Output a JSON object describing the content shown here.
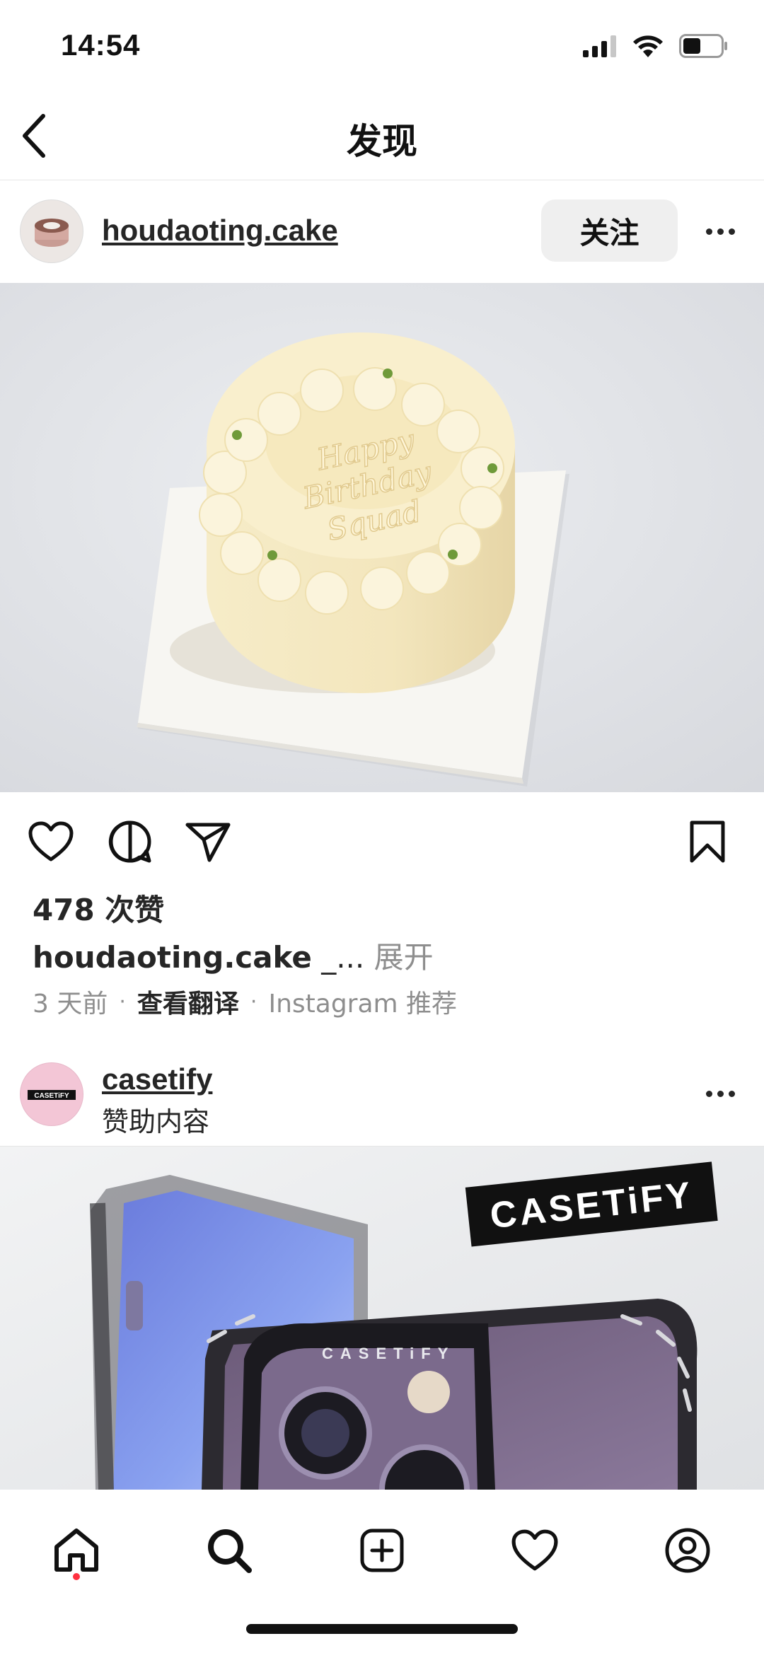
{
  "status_bar": {
    "time": "14:54"
  },
  "header": {
    "title": "发现"
  },
  "post": {
    "username": "houdaoting.cake",
    "follow_label": "关注",
    "cake_text": [
      "Happy",
      "Birthday",
      "Squad"
    ],
    "likes": "478 次赞",
    "caption_user": "houdaoting.cake",
    "caption_truncated": " _...",
    "caption_expand": " 展开",
    "time_ago": "3 天前",
    "translate_label": "查看翻译",
    "recommended": "Instagram 推荐"
  },
  "ad": {
    "username": "casetify",
    "sponsored_label": "赞助内容",
    "avatar_logo": "CASETiFY",
    "brand_logo": "CASETiFY",
    "case_ring_text": "CASETiFY"
  },
  "icons": {
    "back": "chevron-left-icon",
    "like": "heart-icon",
    "comment": "comment-icon",
    "share": "paper-plane-icon",
    "save": "bookmark-icon",
    "more": "more-horizontal-icon",
    "nav": [
      "home-icon",
      "search-icon",
      "create-icon",
      "activity-heart-icon",
      "profile-icon"
    ]
  },
  "colors": {
    "follow_bg": "#efefef",
    "notification_dot": "#ff3040",
    "muted_text": "#8e8e8e",
    "ad_avatar_bg": "#f3c6d6"
  }
}
